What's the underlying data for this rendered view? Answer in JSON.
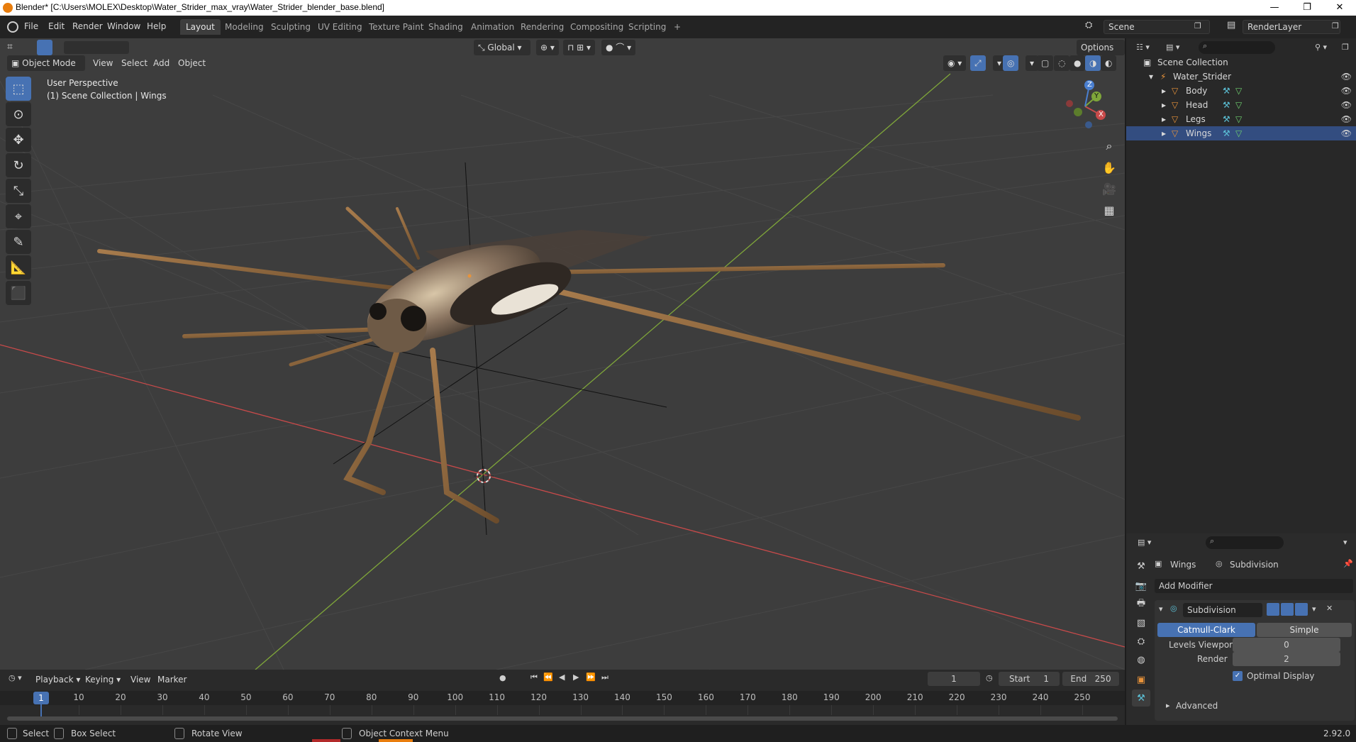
{
  "window": {
    "title": "Blender* [C:\\Users\\MOLEX\\Desktop\\Water_Strider_max_vray\\Water_Strider_blender_base.blend]",
    "minimize": "—",
    "maximize": "❐",
    "close": "✕"
  },
  "menu": {
    "items": [
      "File",
      "Edit",
      "Render",
      "Window",
      "Help"
    ],
    "workspaces": [
      "Layout",
      "Modeling",
      "Sculpting",
      "UV Editing",
      "Texture Paint",
      "Shading",
      "Animation",
      "Rendering",
      "Compositing",
      "Scripting"
    ],
    "add_workspace": "+",
    "scene": "Scene",
    "view_layer": "RenderLayer"
  },
  "viewport": {
    "transform_orientation": "Global",
    "options": "Options",
    "mode": "Object Mode",
    "menus": [
      "View",
      "Select",
      "Add",
      "Object"
    ],
    "perspective": "User Perspective",
    "collection_info": "(1) Scene Collection | Wings",
    "axis_x": "X",
    "axis_y": "Y",
    "axis_z": "Z"
  },
  "tools": [
    "select-box",
    "cursor",
    "move",
    "rotate",
    "scale",
    "transform",
    "annotate",
    "measure",
    "add-cube"
  ],
  "outliner": {
    "root": "Scene Collection",
    "collection": "Water_Strider",
    "objects": [
      "Body",
      "Head",
      "Legs",
      "Wings"
    ]
  },
  "properties": {
    "object": "Wings",
    "modifier_tab": "Subdivision",
    "add_modifier": "Add Modifier",
    "modifier_name": "Subdivision",
    "type_catmull": "Catmull-Clark",
    "type_simple": "Simple",
    "levels_viewport_label": "Levels Viewport",
    "levels_viewport": "0",
    "render_label": "Render",
    "render": "2",
    "optimal_display": "Optimal Display",
    "advanced": "Advanced"
  },
  "timeline": {
    "menus": [
      "Playback",
      "Keying",
      "View",
      "Marker"
    ],
    "current_frame": "1",
    "start_label": "Start",
    "start": "1",
    "end_label": "End",
    "end": "250",
    "ticks": [
      10,
      20,
      30,
      40,
      50,
      60,
      70,
      80,
      90,
      100,
      110,
      120,
      130,
      140,
      150,
      160,
      170,
      180,
      190,
      200,
      210,
      220,
      230,
      240,
      250
    ],
    "playhead": "1"
  },
  "status": {
    "select": "Select",
    "box_select": "Box Select",
    "rotate_view": "Rotate View",
    "context_menu": "Object Context Menu",
    "version": "2.92.0"
  },
  "colors": {
    "accent": "#4772b3",
    "x_axis": "#c84a4a",
    "y_axis": "#7fa63a",
    "z_axis": "#4a7fd0",
    "object_orange": "#e8933a",
    "modifier_cyan": "#5cc0d6",
    "mesh_green": "#6fd06f"
  }
}
